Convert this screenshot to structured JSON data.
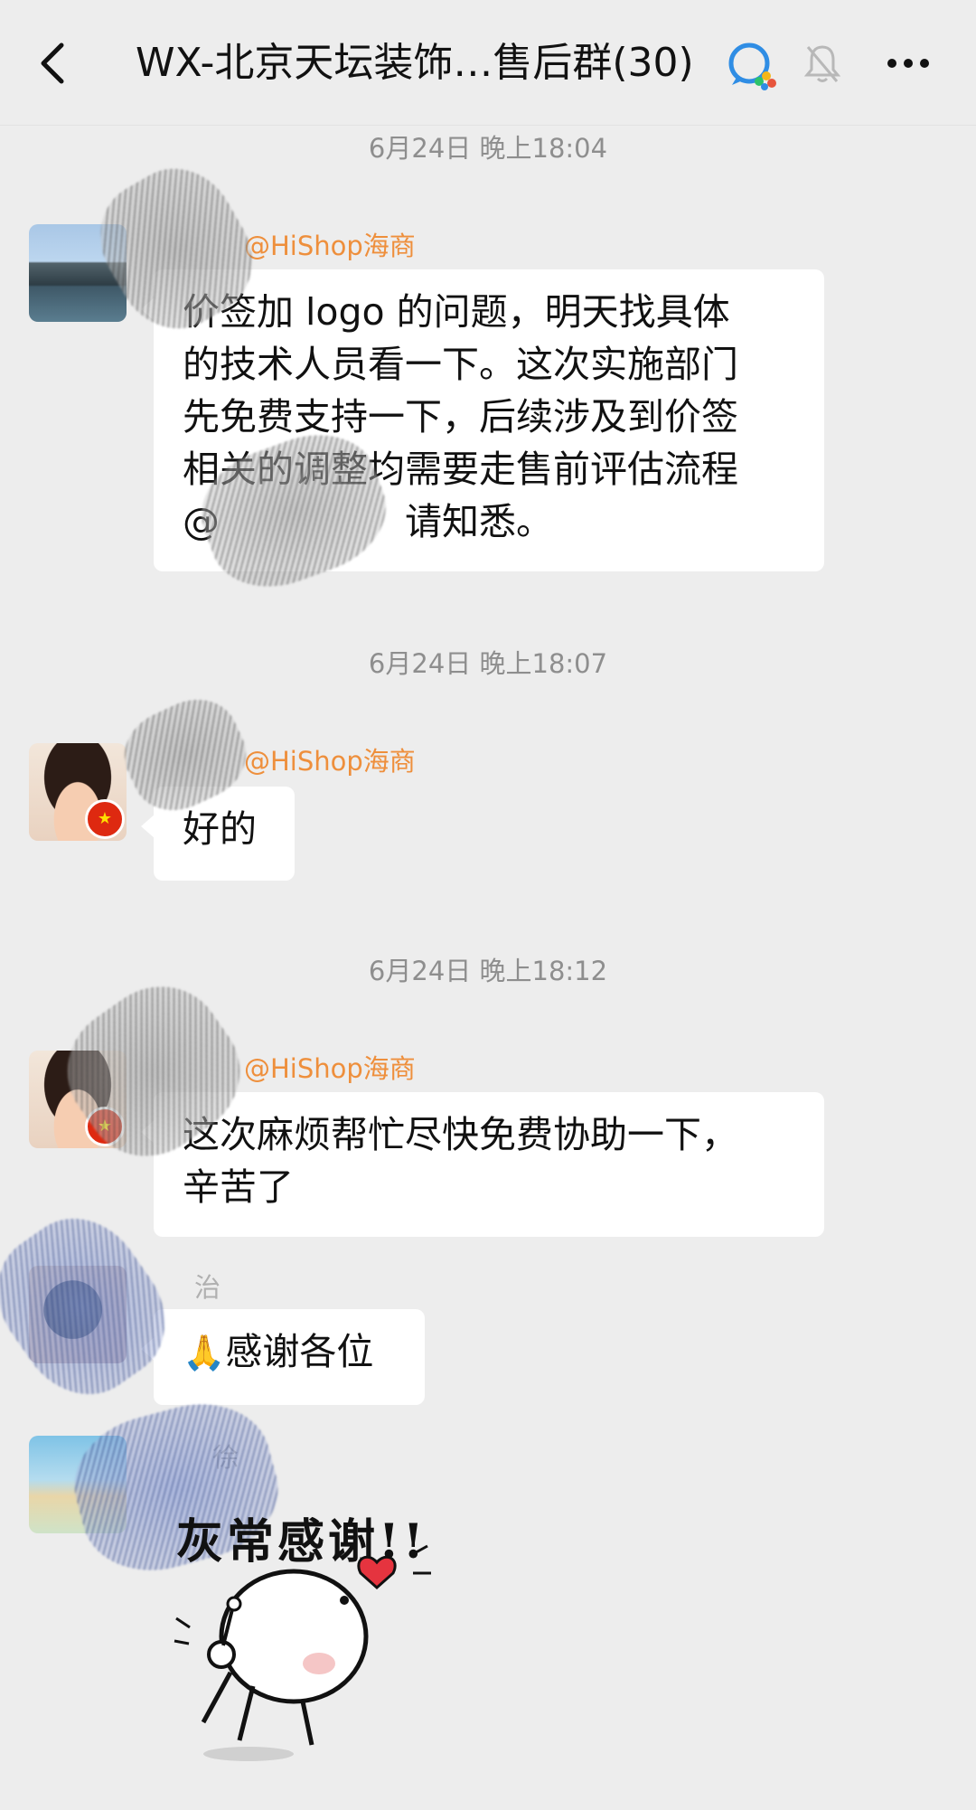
{
  "header": {
    "back_icon": "chevron-left-icon",
    "title": "WX-北京天坛装饰…售后群(30)",
    "wecom_icon": "wecom-icon",
    "mute_icon": "bell-muted-icon",
    "more_icon": "more-dots-icon"
  },
  "messages": [
    {
      "timestamp": "6月24日 晚上18:04",
      "sender_mention": "@HiShop海商",
      "lines": [
        "价签加 logo 的问题，明天找具体",
        "的技术人员看一下。这次实施部门",
        "先免费支持一下，后续涉及到价签",
        "相关的调整均需要走售前评估流程",
        "@　　　　　请知悉。"
      ]
    },
    {
      "timestamp": "6月24日 晚上18:07",
      "sender_mention": "@HiShop海商",
      "lines": [
        "好的"
      ]
    },
    {
      "timestamp": "6月24日 晚上18:12",
      "sender_mention": "@HiShop海商",
      "lines": [
        "这次麻烦帮忙尽快免费协助一下，",
        "辛苦了"
      ]
    },
    {
      "sender_name": "治",
      "emoji": "🙏",
      "text": "感谢各位"
    },
    {
      "sender_name": "徐",
      "sticker_text": "灰常感谢!!"
    }
  ],
  "colors": {
    "background": "#ededed",
    "bubble": "#ffffff",
    "mention": "#ee8f3c",
    "timestamp": "#8e8e8e"
  }
}
